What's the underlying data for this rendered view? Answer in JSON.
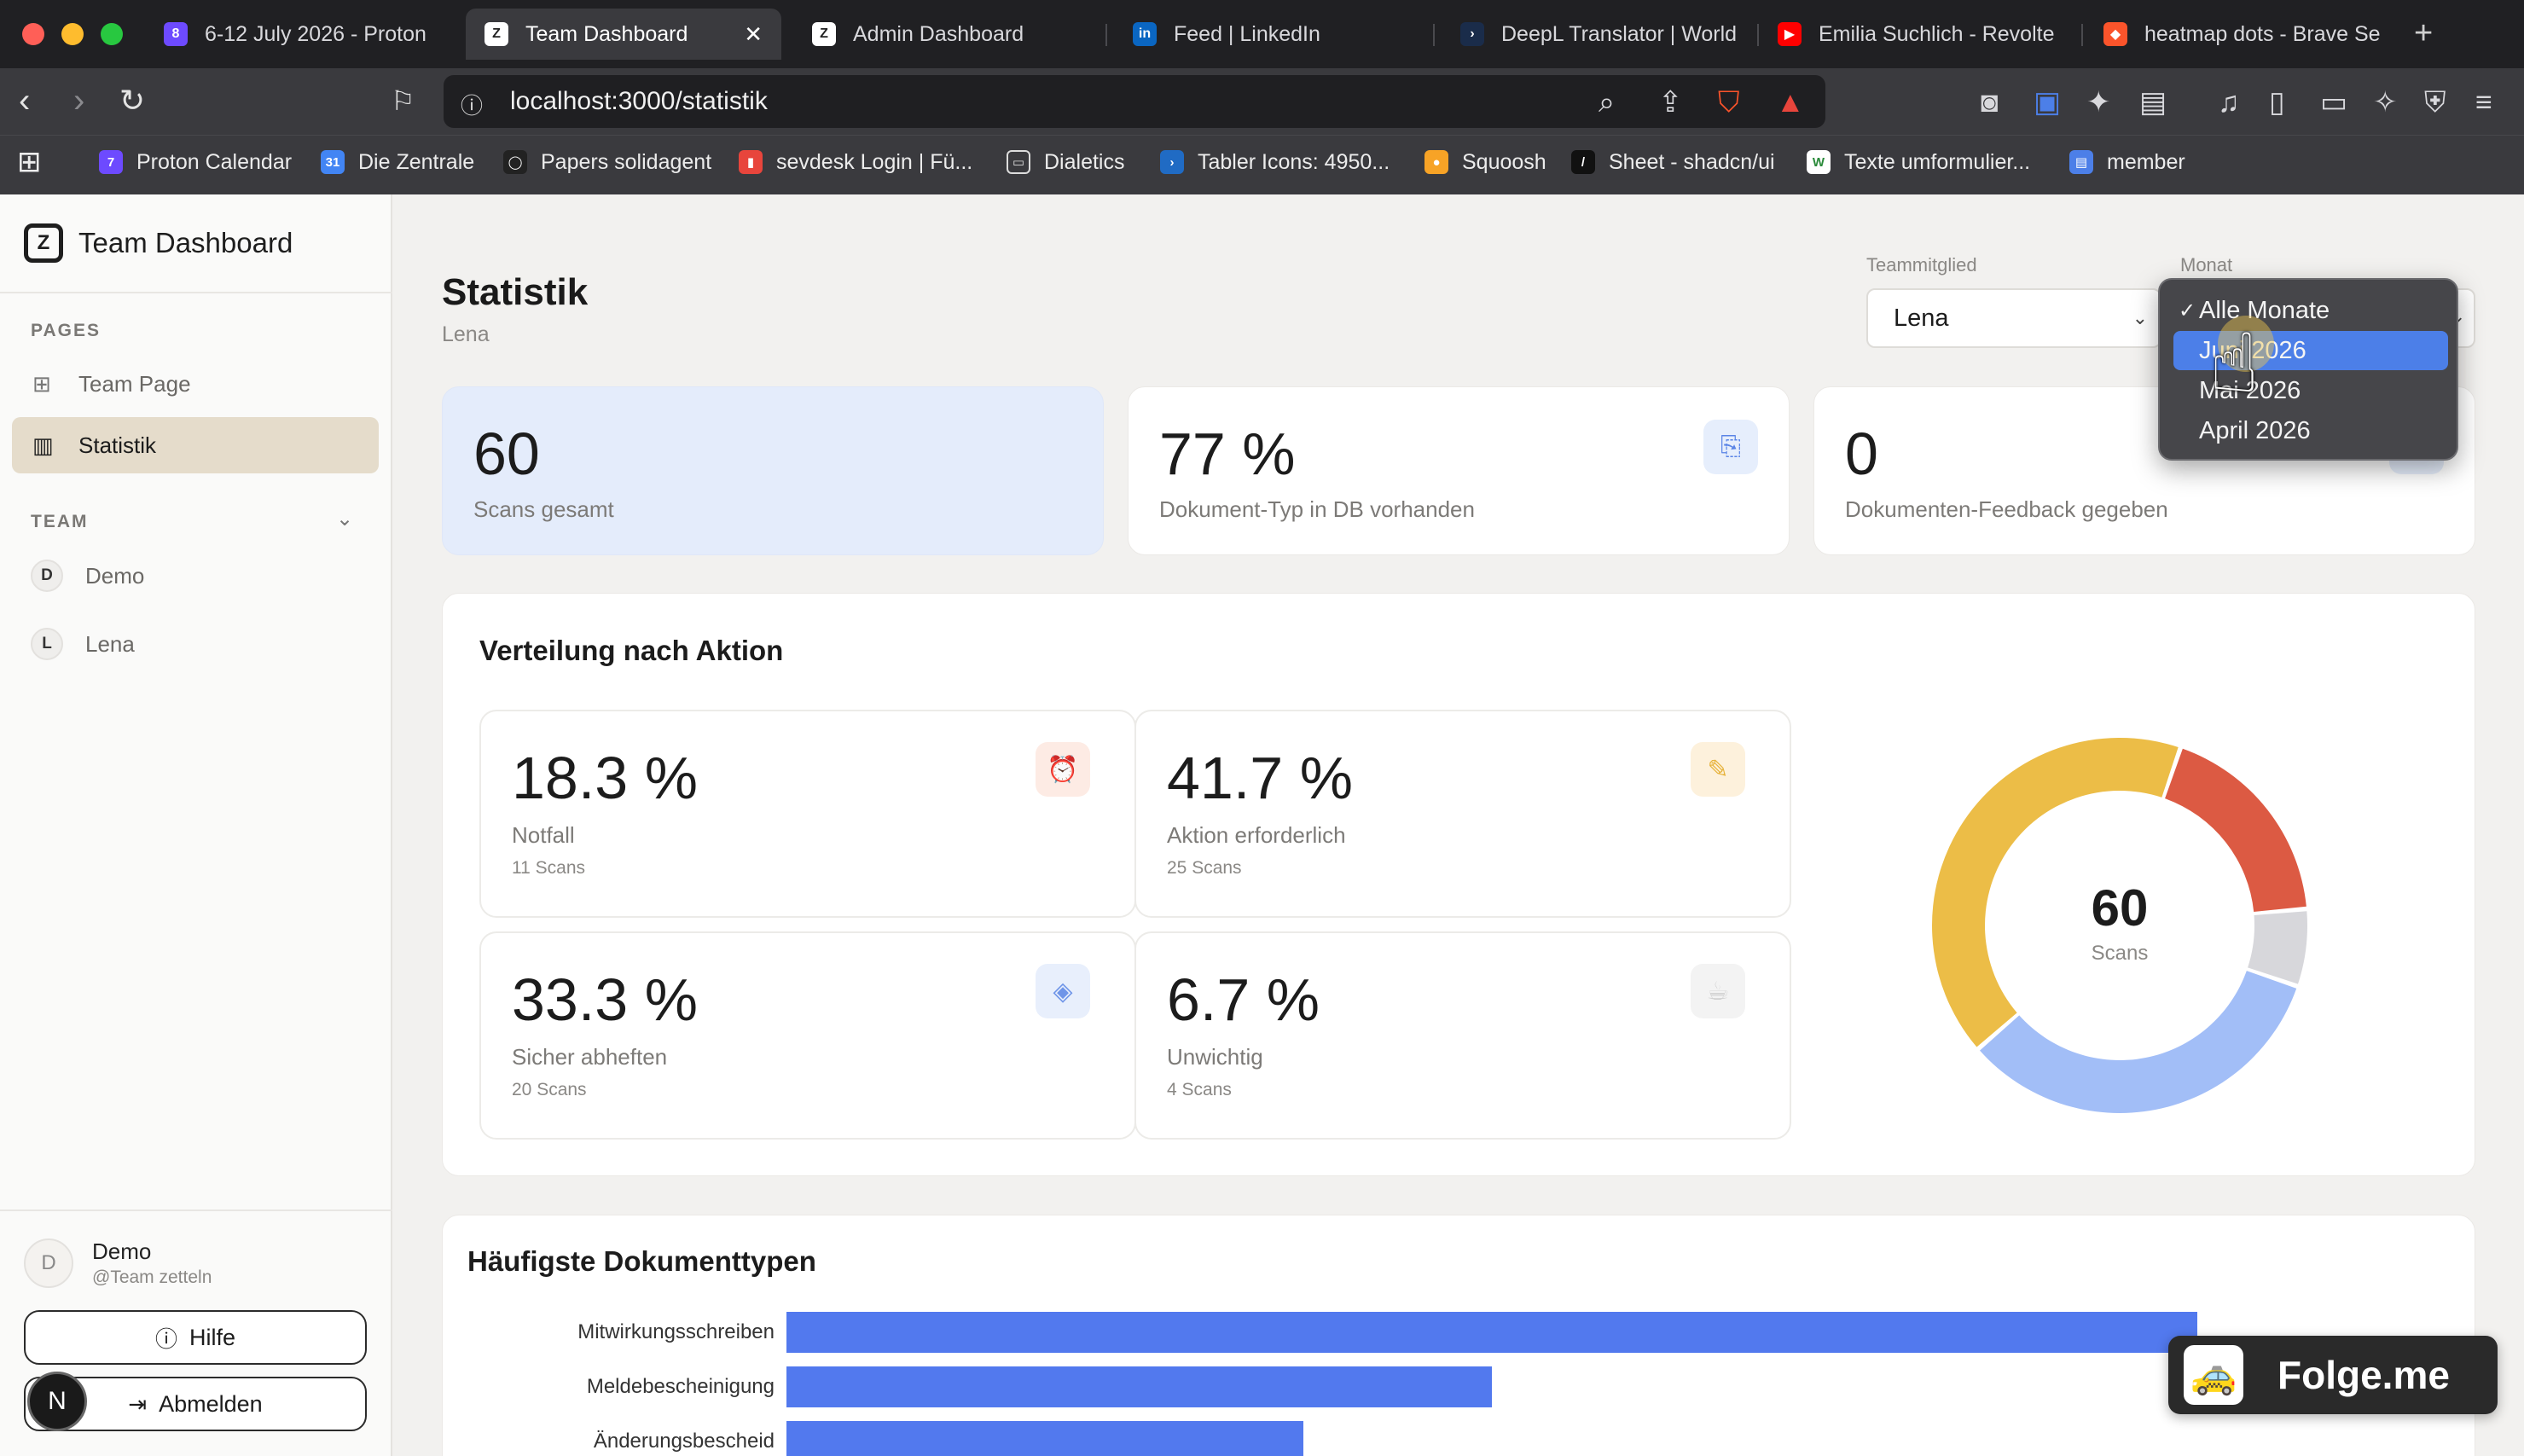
{
  "browser": {
    "tabs": [
      {
        "title": "6-12 July 2026 - Proton",
        "fav": "8",
        "fav_color": "#6d4aff"
      },
      {
        "title": "Team Dashboard",
        "fav": "Z",
        "fav_color": "#ffffff",
        "active": true
      },
      {
        "title": "Admin Dashboard",
        "fav": "Z",
        "fav_color": "#ffffff"
      },
      {
        "title": "Feed | LinkedIn",
        "fav": "in",
        "fav_color": "#0a66c2"
      },
      {
        "title": "DeepL Translator | World",
        "fav": "›",
        "fav_color": "#1a2c4a"
      },
      {
        "title": "Emilia Suchlich - Revolte",
        "fav": "▶",
        "fav_color": "#ff0000"
      },
      {
        "title": "heatmap dots - Brave Se",
        "fav": "◆",
        "fav_color": "#fb542b"
      }
    ],
    "close_tab_glyph": "✕",
    "new_tab_glyph": "+",
    "url": "localhost:3000/statistik",
    "bookmarks": [
      {
        "label": "Proton Calendar",
        "fav": "7",
        "color": "#6d4aff"
      },
      {
        "label": "Die Zentrale",
        "fav": "31",
        "color": "#4285f4"
      },
      {
        "label": "Papers solidagent",
        "fav": "◯",
        "color": "#222222"
      },
      {
        "label": "sevdesk Login | Fü...",
        "fav": "▮",
        "color": "#e8453c"
      },
      {
        "label": "Dialetics",
        "fav": "▭",
        "color": "#3a3a3e"
      },
      {
        "label": "Tabler Icons: 4950...",
        "fav": "›",
        "color": "#206bc4"
      },
      {
        "label": "Squoosh",
        "fav": "●",
        "color": "#f7a326"
      },
      {
        "label": "Sheet - shadcn/ui",
        "fav": "/",
        "color": "#111111"
      },
      {
        "label": "Texte umformulier...",
        "fav": "W",
        "color": "#ffffff"
      },
      {
        "label": "member",
        "fav": "▤",
        "color": "#4c7fe8"
      }
    ]
  },
  "sidebar": {
    "brand": "Team Dashboard",
    "brand_logo": "Z",
    "pages_label": "PAGES",
    "pages": [
      {
        "label": "Team Page",
        "icon": "grid-icon",
        "glyph": "⊞"
      },
      {
        "label": "Statistik",
        "icon": "bar-chart-icon",
        "glyph": "▥",
        "active": true
      }
    ],
    "team_label": "TEAM",
    "team": [
      {
        "initial": "D",
        "name": "Demo"
      },
      {
        "initial": "L",
        "name": "Lena"
      }
    ],
    "user": {
      "initial": "D",
      "name": "Demo",
      "handle": "@Team zetteln"
    },
    "help_label": "Hilfe",
    "logout_label": "Abmelden",
    "n_badge": "N"
  },
  "header": {
    "title": "Statistik",
    "subtitle": "Lena",
    "member_label": "Teammitglied",
    "member_value": "Lena",
    "month_label": "Monat"
  },
  "month_dropdown": {
    "options": [
      {
        "label": "Alle Monate",
        "checked": true
      },
      {
        "label": "Juni 2026",
        "highlighted": true
      },
      {
        "label": "Mai 2026"
      },
      {
        "label": "April 2026"
      }
    ]
  },
  "stats": [
    {
      "value": "60",
      "label": "Scans gesamt",
      "bg": "#e4ecfb"
    },
    {
      "value": "77 %",
      "label": "Dokument-Typ in DB vorhanden",
      "icon": "file-sync-icon"
    },
    {
      "value": "0",
      "label": "Dokumenten-Feedback gegeben",
      "icon": "feedback-icon"
    }
  ],
  "distribution": {
    "title": "Verteilung nach Aktion",
    "items": [
      {
        "value": "18.3 %",
        "label": "Notfall",
        "count": "11 Scans",
        "icon": "alarm-icon",
        "glyph": "⏰",
        "icon_bg": "#fdebe4",
        "icon_color": "#e0583c"
      },
      {
        "value": "41.7 %",
        "label": "Aktion erforderlich",
        "count": "25 Scans",
        "icon": "pencil-icon",
        "glyph": "✎",
        "icon_bg": "#fdf1dc",
        "icon_color": "#e7b33c"
      },
      {
        "value": "33.3 %",
        "label": "Sicher abheften",
        "count": "20 Scans",
        "icon": "box-icon",
        "glyph": "◈",
        "icon_bg": "#e8effc",
        "icon_color": "#6f95e8"
      },
      {
        "value": "6.7 %",
        "label": "Unwichtig",
        "count": "4 Scans",
        "icon": "coffee-icon",
        "glyph": "☕",
        "icon_bg": "#f3f3f3",
        "icon_color": "#cfcfcf"
      }
    ],
    "donut_total": "60",
    "donut_label": "Scans"
  },
  "chart_data": [
    {
      "type": "pie",
      "categories": [
        "Notfall",
        "Unwichtig",
        "Sicher abheften",
        "Aktion erforderlich"
      ],
      "values": [
        11,
        4,
        20,
        25
      ],
      "colors": [
        "#dc5a43",
        "#d7d7db",
        "#a2bef7",
        "#ecbd47"
      ],
      "title": ""
    },
    {
      "type": "bar",
      "orientation": "horizontal",
      "categories": [
        "Mitwirkungsschreiben",
        "Meldebescheinigung",
        "Änderungsbescheid"
      ],
      "values": [
        12,
        6,
        4.4
      ],
      "xlim": [
        0,
        12
      ],
      "title": "Häufigste Dokumenttypen"
    }
  ],
  "docs": {
    "title": "Häufigste Dokumenttypen"
  },
  "folge": {
    "label": "Folge.me",
    "icon": "taxi-icon",
    "glyph": "🚕"
  }
}
